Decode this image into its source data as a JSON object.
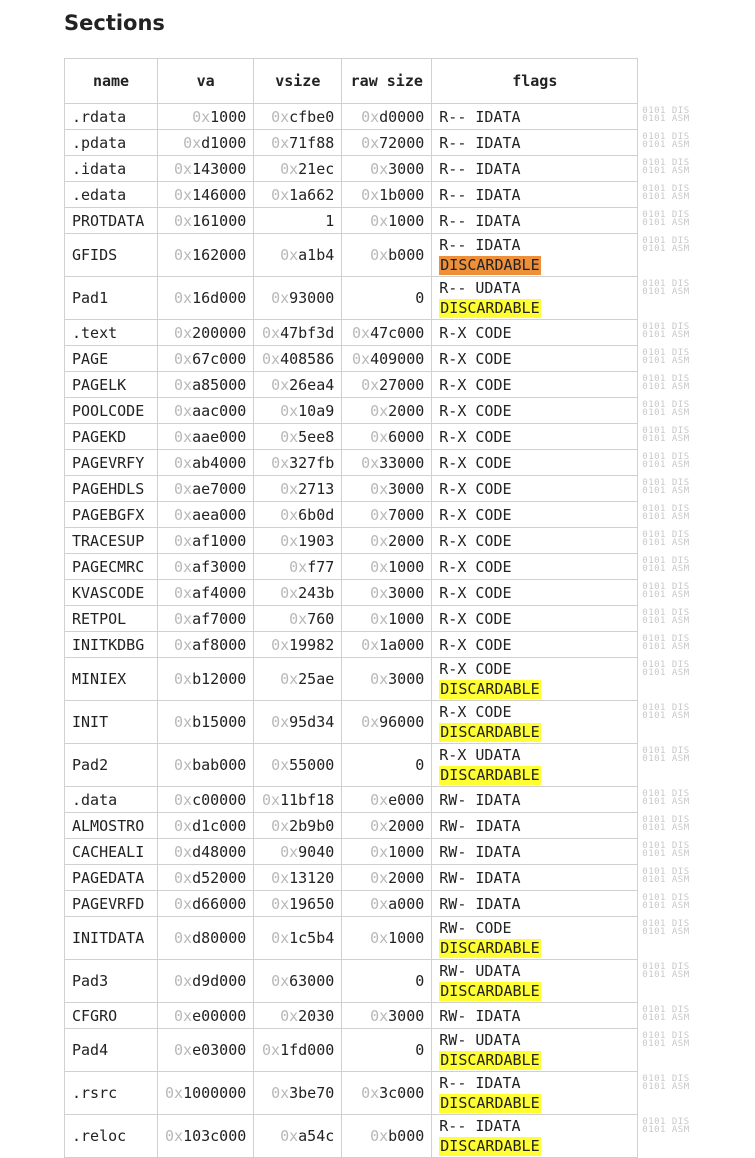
{
  "title": "Sections",
  "columns": [
    "name",
    "va",
    "vsize",
    "raw size",
    "flags"
  ],
  "hex_prefix": "0x",
  "disasm_icon": {
    "line1": "0101 DIS",
    "line2": "0101 ASM"
  },
  "colors": {
    "discardable": "#ffff33",
    "discardable_highlight": "#ee8f3a",
    "hex_prefix": "#b8b8b8"
  },
  "sections": [
    {
      "name": ".rdata",
      "va": "1000",
      "vsize": "cfbe0",
      "raw": "d0000",
      "flags": "R-- IDATA",
      "tag": ""
    },
    {
      "name": ".pdata",
      "va": "d1000",
      "vsize": "71f88",
      "raw": "72000",
      "flags": "R-- IDATA",
      "tag": ""
    },
    {
      "name": ".idata",
      "va": "143000",
      "vsize": "21ec",
      "raw": "3000",
      "flags": "R-- IDATA",
      "tag": ""
    },
    {
      "name": ".edata",
      "va": "146000",
      "vsize": "1a662",
      "raw": "1b000",
      "flags": "R-- IDATA",
      "tag": ""
    },
    {
      "name": "PROTDATA",
      "va": "161000",
      "vsize": "1",
      "raw": "1000",
      "flags": "R-- IDATA",
      "tag": "",
      "vsize_plain": true
    },
    {
      "name": "GFIDS",
      "va": "162000",
      "vsize": "a1b4",
      "raw": "b000",
      "flags": "R-- IDATA",
      "tag": "DISCARDABLE",
      "tag_style": "orange"
    },
    {
      "name": "Pad1",
      "va": "16d000",
      "vsize": "93000",
      "raw": "0",
      "flags": "R-- UDATA",
      "tag": "DISCARDABLE",
      "raw_plain": true
    },
    {
      "name": ".text",
      "va": "200000",
      "vsize": "47bf3d",
      "raw": "47c000",
      "flags": "R-X CODE",
      "tag": ""
    },
    {
      "name": "PAGE",
      "va": "67c000",
      "vsize": "408586",
      "raw": "409000",
      "flags": "R-X CODE",
      "tag": ""
    },
    {
      "name": "PAGELK",
      "va": "a85000",
      "vsize": "26ea4",
      "raw": "27000",
      "flags": "R-X CODE",
      "tag": ""
    },
    {
      "name": "POOLCODE",
      "va": "aac000",
      "vsize": "10a9",
      "raw": "2000",
      "flags": "R-X CODE",
      "tag": ""
    },
    {
      "name": "PAGEKD",
      "va": "aae000",
      "vsize": "5ee8",
      "raw": "6000",
      "flags": "R-X CODE",
      "tag": ""
    },
    {
      "name": "PAGEVRFY",
      "va": "ab4000",
      "vsize": "327fb",
      "raw": "33000",
      "flags": "R-X CODE",
      "tag": ""
    },
    {
      "name": "PAGEHDLS",
      "va": "ae7000",
      "vsize": "2713",
      "raw": "3000",
      "flags": "R-X CODE",
      "tag": ""
    },
    {
      "name": "PAGEBGFX",
      "va": "aea000",
      "vsize": "6b0d",
      "raw": "7000",
      "flags": "R-X CODE",
      "tag": ""
    },
    {
      "name": "TRACESUP",
      "va": "af1000",
      "vsize": "1903",
      "raw": "2000",
      "flags": "R-X CODE",
      "tag": ""
    },
    {
      "name": "PAGECMRC",
      "va": "af3000",
      "vsize": "f77",
      "raw": "1000",
      "flags": "R-X CODE",
      "tag": ""
    },
    {
      "name": "KVASCODE",
      "va": "af4000",
      "vsize": "243b",
      "raw": "3000",
      "flags": "R-X CODE",
      "tag": ""
    },
    {
      "name": "RETPOL",
      "va": "af7000",
      "vsize": "760",
      "raw": "1000",
      "flags": "R-X CODE",
      "tag": ""
    },
    {
      "name": "INITKDBG",
      "va": "af8000",
      "vsize": "19982",
      "raw": "1a000",
      "flags": "R-X CODE",
      "tag": ""
    },
    {
      "name": "MINIEX",
      "va": "b12000",
      "vsize": "25ae",
      "raw": "3000",
      "flags": "R-X CODE",
      "tag": "DISCARDABLE"
    },
    {
      "name": "INIT",
      "va": "b15000",
      "vsize": "95d34",
      "raw": "96000",
      "flags": "R-X CODE",
      "tag": "DISCARDABLE"
    },
    {
      "name": "Pad2",
      "va": "bab000",
      "vsize": "55000",
      "raw": "0",
      "flags": "R-X UDATA",
      "tag": "DISCARDABLE",
      "raw_plain": true
    },
    {
      "name": ".data",
      "va": "c00000",
      "vsize": "11bf18",
      "raw": "e000",
      "flags": "RW- IDATA",
      "tag": ""
    },
    {
      "name": "ALMOSTRO",
      "va": "d1c000",
      "vsize": "2b9b0",
      "raw": "2000",
      "flags": "RW- IDATA",
      "tag": ""
    },
    {
      "name": "CACHEALI",
      "va": "d48000",
      "vsize": "9040",
      "raw": "1000",
      "flags": "RW- IDATA",
      "tag": ""
    },
    {
      "name": "PAGEDATA",
      "va": "d52000",
      "vsize": "13120",
      "raw": "2000",
      "flags": "RW- IDATA",
      "tag": ""
    },
    {
      "name": "PAGEVRFD",
      "va": "d66000",
      "vsize": "19650",
      "raw": "a000",
      "flags": "RW- IDATA",
      "tag": ""
    },
    {
      "name": "INITDATA",
      "va": "d80000",
      "vsize": "1c5b4",
      "raw": "1000",
      "flags": "RW- CODE",
      "tag": "DISCARDABLE"
    },
    {
      "name": "Pad3",
      "va": "d9d000",
      "vsize": "63000",
      "raw": "0",
      "flags": "RW- UDATA",
      "tag": "DISCARDABLE",
      "raw_plain": true
    },
    {
      "name": "CFGRO",
      "va": "e00000",
      "vsize": "2030",
      "raw": "3000",
      "flags": "RW- IDATA",
      "tag": ""
    },
    {
      "name": "Pad4",
      "va": "e03000",
      "vsize": "1fd000",
      "raw": "0",
      "flags": "RW- UDATA",
      "tag": "DISCARDABLE",
      "raw_plain": true
    },
    {
      "name": ".rsrc",
      "va": "1000000",
      "vsize": "3be70",
      "raw": "3c000",
      "flags": "R-- IDATA",
      "tag": "DISCARDABLE"
    },
    {
      "name": ".reloc",
      "va": "103c000",
      "vsize": "a54c",
      "raw": "b000",
      "flags": "R-- IDATA",
      "tag": "DISCARDABLE"
    }
  ]
}
